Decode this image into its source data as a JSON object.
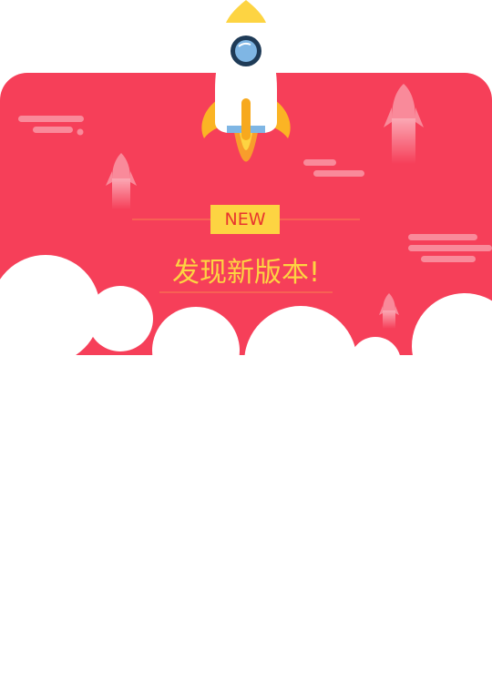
{
  "dialog": {
    "badge": "NEW",
    "title": "发现新版本!"
  },
  "colors": {
    "banner": "#f63f59",
    "accent_yellow": "#fdd442",
    "badge_text": "#e8352f",
    "cloud": "#ffffff",
    "deco_pink": "#f98a9a"
  },
  "icons": {
    "rocket": "rocket-icon",
    "small_rockets": "small-rocket-icon",
    "clouds": "cloud-icon"
  }
}
